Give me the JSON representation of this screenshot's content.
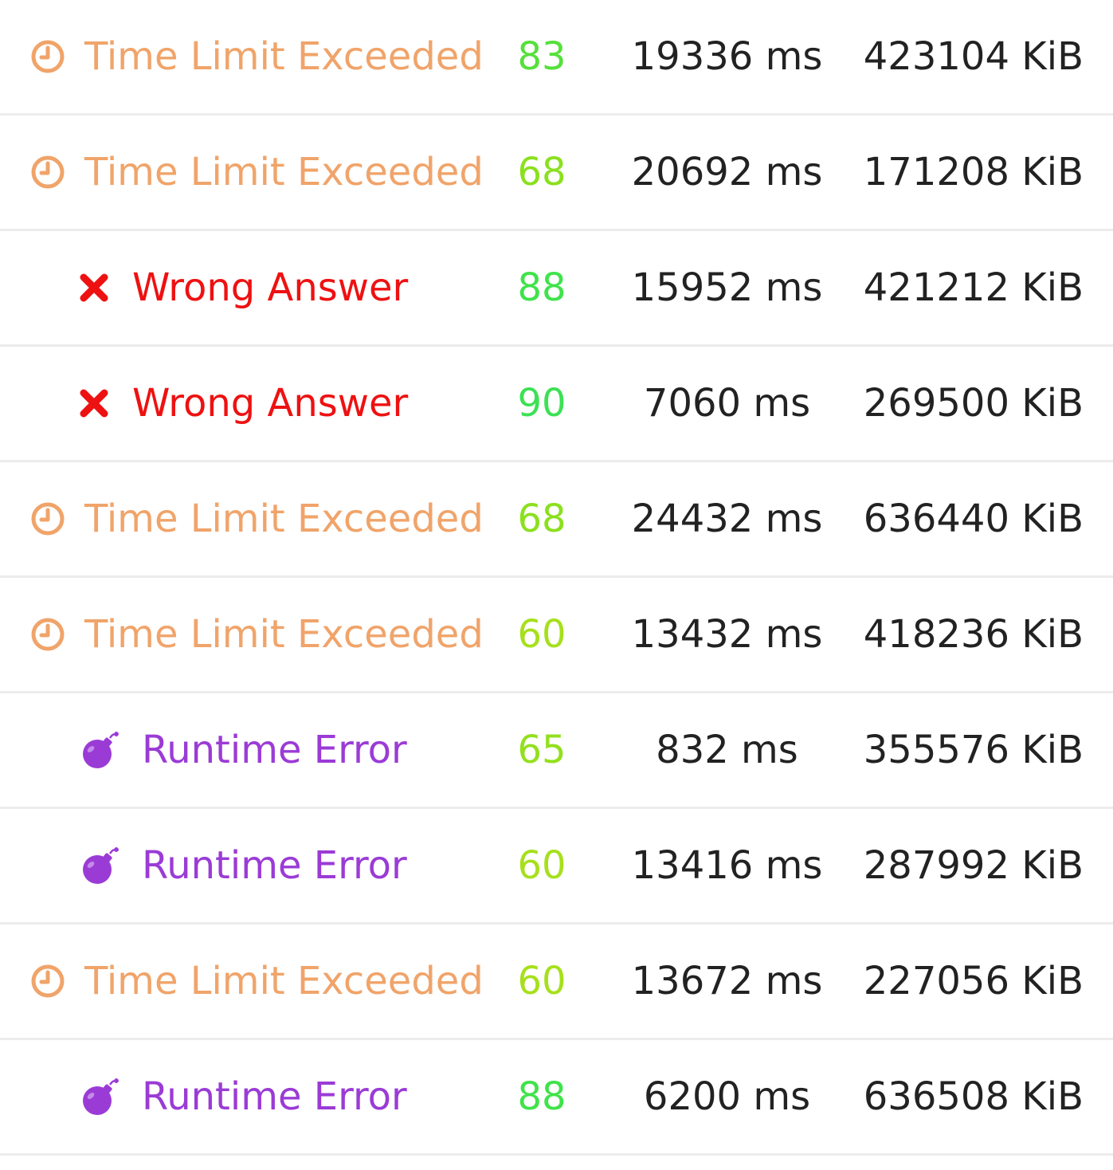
{
  "colors": {
    "tle": "#f0a46a",
    "wa": "#ee1111",
    "re": "#9b3bd6",
    "text": "#222222",
    "divider": "#ececec"
  },
  "rows": [
    {
      "status": "Time Limit Exceeded",
      "kind": "tle",
      "icon": "clock-icon",
      "score": "83",
      "score_color": "#55e03a",
      "time": "19336 ms",
      "memory": "423104 KiB"
    },
    {
      "status": "Time Limit Exceeded",
      "kind": "tle",
      "icon": "clock-icon",
      "score": "68",
      "score_color": "#8be01e",
      "time": "20692 ms",
      "memory": "171208 KiB"
    },
    {
      "status": "Wrong Answer",
      "kind": "wa",
      "icon": "cross-icon",
      "score": "88",
      "score_color": "#3fe34a",
      "time": "15952 ms",
      "memory": "421212 KiB"
    },
    {
      "status": "Wrong Answer",
      "kind": "wa",
      "icon": "cross-icon",
      "score": "90",
      "score_color": "#3ce154",
      "time": "7060 ms",
      "memory": "269500 KiB"
    },
    {
      "status": "Time Limit Exceeded",
      "kind": "tle",
      "icon": "clock-icon",
      "score": "68",
      "score_color": "#8be01e",
      "time": "24432 ms",
      "memory": "636440 KiB"
    },
    {
      "status": "Time Limit Exceeded",
      "kind": "tle",
      "icon": "clock-icon",
      "score": "60",
      "score_color": "#a6e01c",
      "time": "13432 ms",
      "memory": "418236 KiB"
    },
    {
      "status": "Runtime Error",
      "kind": "re",
      "icon": "bomb-icon",
      "score": "65",
      "score_color": "#93e01e",
      "time": "832 ms",
      "memory": "355576 KiB"
    },
    {
      "status": "Runtime Error",
      "kind": "re",
      "icon": "bomb-icon",
      "score": "60",
      "score_color": "#a6e01c",
      "time": "13416 ms",
      "memory": "287992 KiB"
    },
    {
      "status": "Time Limit Exceeded",
      "kind": "tle",
      "icon": "clock-icon",
      "score": "60",
      "score_color": "#a6e01c",
      "time": "13672 ms",
      "memory": "227056 KiB"
    },
    {
      "status": "Runtime Error",
      "kind": "re",
      "icon": "bomb-icon",
      "score": "88",
      "score_color": "#3fe34a",
      "time": "6200 ms",
      "memory": "636508 KiB"
    }
  ]
}
